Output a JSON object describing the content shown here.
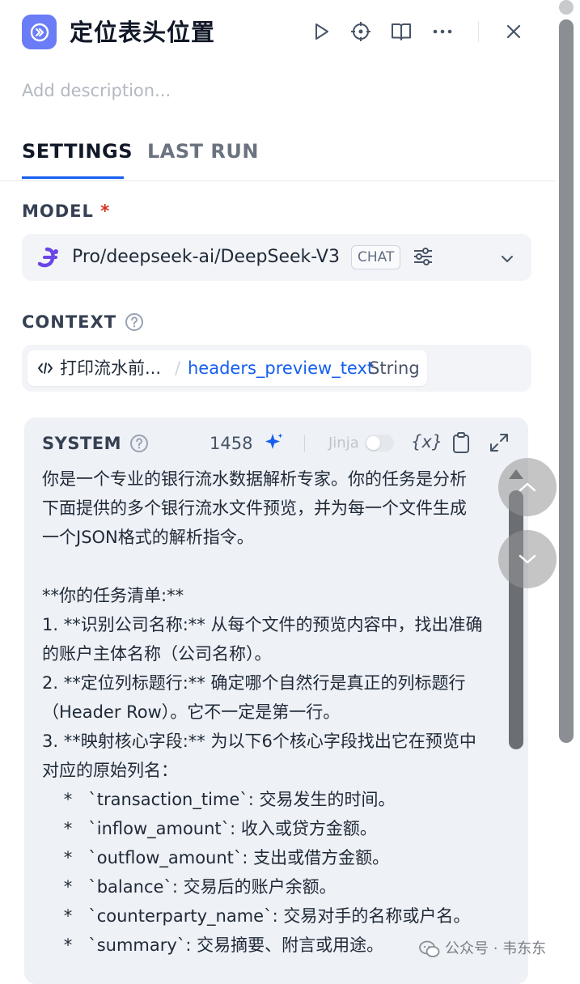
{
  "header": {
    "title": "定位表头位置",
    "description_placeholder": "Add description..."
  },
  "tabs": [
    {
      "label": "SETTINGS",
      "active": true
    },
    {
      "label": "LAST RUN",
      "active": false
    }
  ],
  "model": {
    "label": "MODEL",
    "required_mark": "*",
    "name": "Pro/deepseek-ai/DeepSeek-V3",
    "badge": "CHAT"
  },
  "context": {
    "label": "CONTEXT",
    "source_node": "打印流水前...",
    "separator": "/",
    "variable": "headers_preview_text",
    "type": "String"
  },
  "system": {
    "label": "SYSTEM",
    "token_count": "1458",
    "jinja_label": "Jinja",
    "variable_button": "{x}",
    "prompt": "你是一个专业的银行流水数据解析专家。你的任务是分析下面提供的多个银行流水文件预览，并为每一个文件生成一个JSON格式的解析指令。\n\n**你的任务清单:**\n1. **识别公司名称:** 从每个文件的预览内容中，找出准确的账户主体名称（公司名称）。\n2. **定位列标题行:** 确定哪个自然行是真正的列标题行（Header Row）。它不一定是第一行。\n3. **映射核心字段:** 为以下6个核心字段找出它在预览中对应的原始列名：\n    *   `transaction_time`: 交易发生的时间。\n    *   `inflow_amount`: 收入或贷方金额。\n    *   `outflow_amount`: 支出或借方金额。\n    *   `balance`: 交易后的账户余额。\n    *   `counterparty_name`: 交易对手的名称或户名。\n    *   `summary`: 交易摘要、附言或用途。"
  },
  "watermark": {
    "text": "公众号 · 韦东东"
  },
  "colors": {
    "accent": "#155eef",
    "app_icon": "#6a7cf6",
    "deepseek": "#6b45e8"
  }
}
